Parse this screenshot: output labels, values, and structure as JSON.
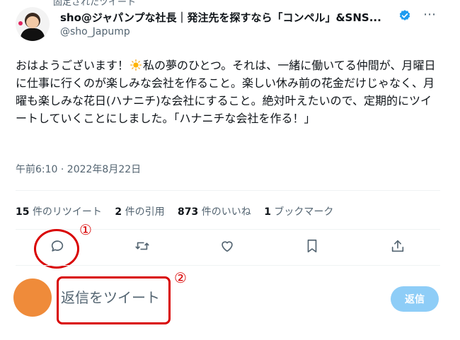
{
  "header": {
    "pinned_label": "固定されたツイート",
    "display_name": "sho@ジャパンプな社長｜発注先を探すなら「コンペル」&SNS...",
    "handle": "@sho_Japump",
    "more_icon": "⋯",
    "verified_color": "#1d9bf0"
  },
  "tweet": {
    "text_before_emoji": "おはようございます！",
    "emoji": "sun-emoji",
    "text_after_emoji": "私の夢のひとつ。それは、一緒に働いてる仲間が、月曜日に仕事に行くのが楽しみな会社を作ること。楽しい休み前の花金だけじゃなく、月曜も楽しみな花日(ハナニチ)な会社にすること。絶対叶えたいので、定期的にツイートしていくことにしました。「ハナニチな会社を作る！」",
    "timestamp": "午前6:10 · 2022年8月22日"
  },
  "stats": [
    {
      "count": "15",
      "label": "件のリツイート"
    },
    {
      "count": "2",
      "label": "件の引用"
    },
    {
      "count": "873",
      "label": "件のいいね"
    },
    {
      "count": "1",
      "label": "ブックマーク"
    }
  ],
  "actions": [
    "reply-icon",
    "retweet-icon",
    "like-icon",
    "bookmark-icon",
    "share-icon"
  ],
  "annotations": {
    "marker1": "①",
    "marker2": "②",
    "color": "#d90000"
  },
  "reply": {
    "placeholder": "返信をツイート",
    "button_label": "返信",
    "avatar_color": "#ef8b3a",
    "button_color": "#8ecdf7"
  }
}
